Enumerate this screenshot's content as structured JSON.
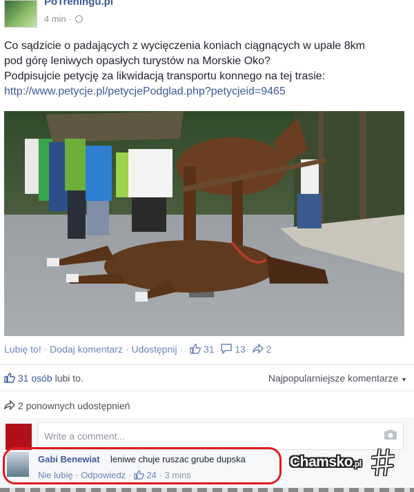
{
  "post": {
    "page_name": "PoTreningu.pl",
    "time": "4 min ·",
    "text_line1": "Co sądzicie o padających z wycięczenia koniach ciągnących w upale 8km",
    "text_line2": "pod górę leniwych opasłych turystów na Morskie Oko?",
    "text_line3": "Podpisujcie petycję za likwidacją transportu konnego na tej trasie:",
    "link": "http://www.petycje.pl/petycjePodglad.php?petycjeid=9465"
  },
  "actions": {
    "like": "Lubię to!",
    "comment": "Dodaj komentarz",
    "share": "Udostępnij",
    "sep": "·",
    "likes_count": "31",
    "comments_count": "13",
    "shares_count": "2"
  },
  "summary": {
    "likes_prefix": "31 osób",
    "likes_suffix": "lubi to.",
    "sort_label": "Najpopularniejsze komentarze",
    "shares": "2 ponownych udostępnień"
  },
  "composer": {
    "placeholder": "Write a comment..."
  },
  "comment": {
    "author": "Gabi Benewiat",
    "text": "leniwe chuje ruszac grube dupska",
    "unlike": "Nie lubię",
    "reply": "Odpowiedz",
    "likes": "24",
    "time": "3 mins"
  },
  "watermark": {
    "brand": "Chamsko",
    "suffix": ".pl"
  },
  "colors": {
    "link": "#3b5998",
    "highlight": "#e0191f"
  }
}
